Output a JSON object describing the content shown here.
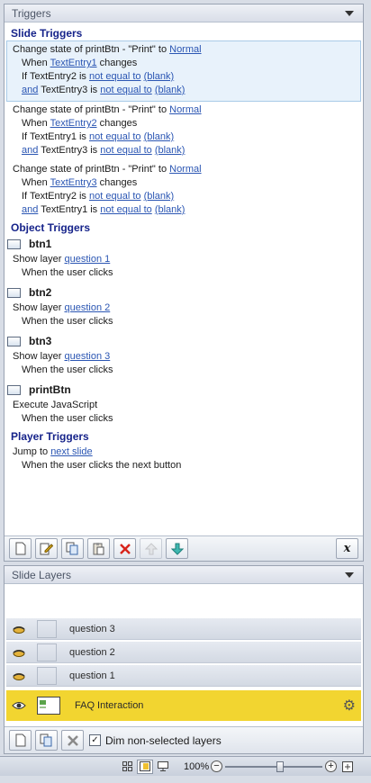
{
  "triggers_panel": {
    "title": "Triggers",
    "slide_triggers_title": "Slide Triggers",
    "slide_triggers": [
      {
        "prefix": "Change state of printBtn - \"Print\" to ",
        "state": "Normal",
        "when_prefix": "When ",
        "when_object": "TextEntry1",
        "when_suffix": " changes",
        "cond1_prefix": "If TextEntry2 is ",
        "cond1_op": "not equal to",
        "cond1_value": "(blank)",
        "cond2_join": "and",
        "cond2_var": " TextEntry3 is ",
        "cond2_op": "not equal to",
        "cond2_value": "(blank)"
      },
      {
        "prefix": "Change state of printBtn - \"Print\" to ",
        "state": "Normal",
        "when_prefix": "When ",
        "when_object": "TextEntry2",
        "when_suffix": " changes",
        "cond1_prefix": "If TextEntry1 is ",
        "cond1_op": "not equal to",
        "cond1_value": "(blank)",
        "cond2_join": "and",
        "cond2_var": " TextEntry3 is ",
        "cond2_op": "not equal to",
        "cond2_value": "(blank)"
      },
      {
        "prefix": "Change state of printBtn - \"Print\" to ",
        "state": "Normal",
        "when_prefix": "When ",
        "when_object": "TextEntry3",
        "when_suffix": " changes",
        "cond1_prefix": "If TextEntry2 is ",
        "cond1_op": "not equal to",
        "cond1_value": "(blank)",
        "cond2_join": "and",
        "cond2_var": " TextEntry1 is ",
        "cond2_op": "not equal to",
        "cond2_value": "(blank)"
      }
    ],
    "object_triggers_title": "Object Triggers",
    "objects": [
      {
        "name": "btn1",
        "action_prefix": "Show layer ",
        "action_link": "question 1",
        "when": "When the user clicks"
      },
      {
        "name": "btn2",
        "action_prefix": "Show layer ",
        "action_link": "question 2",
        "when": "When the user clicks"
      },
      {
        "name": "btn3",
        "action_prefix": "Show layer ",
        "action_link": "question 3",
        "when": "When the user clicks"
      },
      {
        "name": "printBtn",
        "action_prefix": "Execute JavaScript",
        "action_link": "",
        "when": "When the user clicks"
      }
    ],
    "player_triggers_title": "Player Triggers",
    "player_trigger": {
      "action_prefix": "Jump to ",
      "action_link": "next slide",
      "when": "When the user clicks the next button"
    },
    "toolbar": {
      "javascript_label": "x"
    }
  },
  "layers_panel": {
    "title": "Slide Layers",
    "layers": [
      {
        "name": "question 3"
      },
      {
        "name": "question 2"
      },
      {
        "name": "question 1"
      }
    ],
    "base_layer": {
      "name": "FAQ Interaction"
    },
    "dim_label": "Dim non-selected layers",
    "dim_checked": "✓"
  },
  "statusbar": {
    "zoom": "100%",
    "zoom_level": 0.57
  }
}
